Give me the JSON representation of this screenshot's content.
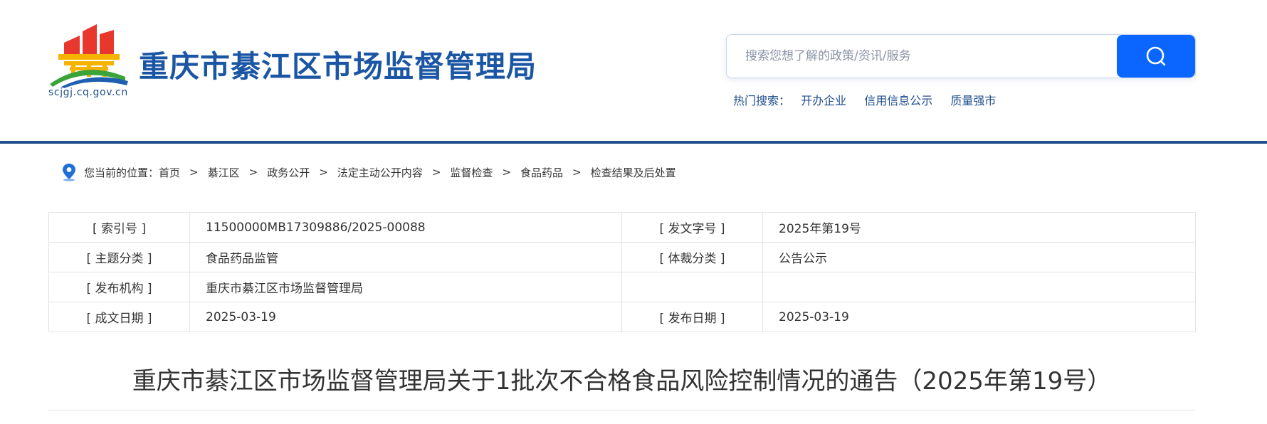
{
  "header": {
    "site_title": "重庆市綦江区市场监督管理局",
    "domain": "scjgj.cq.gov.cn",
    "logo_icon": "government-building-emblem"
  },
  "search": {
    "placeholder": "搜索您想了解的政策/资讯/服务",
    "value": "",
    "button_icon": "search-icon",
    "hot_label": "热门搜索：",
    "hot_items": [
      "开办企业",
      "信用信息公示",
      "质量强市"
    ]
  },
  "breadcrumb": {
    "icon": "location-pin-icon",
    "prefix": "您当前的位置：",
    "items": [
      "首页",
      "綦江区",
      "政务公开",
      "法定主动公开内容",
      "监督检查",
      "食品药品",
      "检查结果及后处置"
    ],
    "separator": ">"
  },
  "meta": {
    "rows": [
      {
        "l1": "[ 索引号 ]",
        "v1": "11500000MB17309886/2025-00088",
        "l2": "[ 发文字号 ]",
        "v2": "2025年第19号"
      },
      {
        "l1": "[ 主题分类 ]",
        "v1": "食品药品监管",
        "l2": "[ 体裁分类 ]",
        "v2": "公告公示"
      },
      {
        "l1": "[ 发布机构 ]",
        "v1": "重庆市綦江区市场监督管理局",
        "l2": "",
        "v2": ""
      },
      {
        "l1": "[ 成文日期 ]",
        "v1": "2025-03-19",
        "l2": "[ 发布日期 ]",
        "v2": "2025-03-19"
      }
    ]
  },
  "article": {
    "title": "重庆市綦江区市场监督管理局关于1批次不合格食品风险控制情况的通告（2025年第19号）"
  },
  "colors": {
    "brand_blue": "#1b56a5",
    "header_line": "#1f4e8c",
    "search_button": "#0a66ff"
  }
}
